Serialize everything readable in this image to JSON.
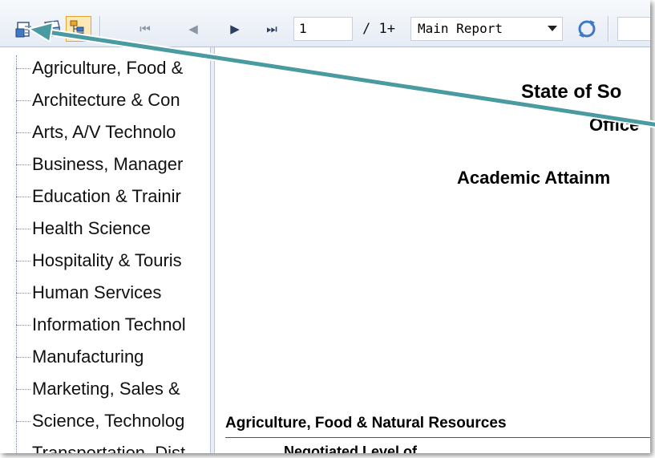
{
  "toolbar": {
    "export_icon": "export-icon",
    "print_icon": "print-icon",
    "group_tree_icon": "group-tree-icon",
    "first_page_icon": "first-page-icon",
    "prev_page_icon": "previous-page-icon",
    "next_page_icon": "next-page-icon",
    "last_page_icon": "last-page-icon",
    "page_number": "1",
    "page_total": "/ 1+",
    "report_selector": "Main Report",
    "refresh_icon": "refresh-icon"
  },
  "tree": {
    "items": [
      {
        "label": "Agriculture, Food &"
      },
      {
        "label": "Architecture & Con"
      },
      {
        "label": "Arts, A/V Technolo"
      },
      {
        "label": "Business, Manager"
      },
      {
        "label": "Education & Trainir"
      },
      {
        "label": "Health Science"
      },
      {
        "label": "Hospitality & Touris"
      },
      {
        "label": "Human Services"
      },
      {
        "label": "Information Technol"
      },
      {
        "label": "Manufacturing"
      },
      {
        "label": "Marketing, Sales &"
      },
      {
        "label": "Science, Technolog"
      },
      {
        "label": "Transportation, Dist"
      }
    ]
  },
  "report": {
    "title": "State of So",
    "office": "Office",
    "heading": "Academic Attainm",
    "section": "Agriculture, Food & Natural Resources",
    "column_header": "Negotiated Level of"
  },
  "colors": {
    "annotation_arrow": "#4a9aa1",
    "toolbar_toggle_bg": "#fde9b7"
  }
}
